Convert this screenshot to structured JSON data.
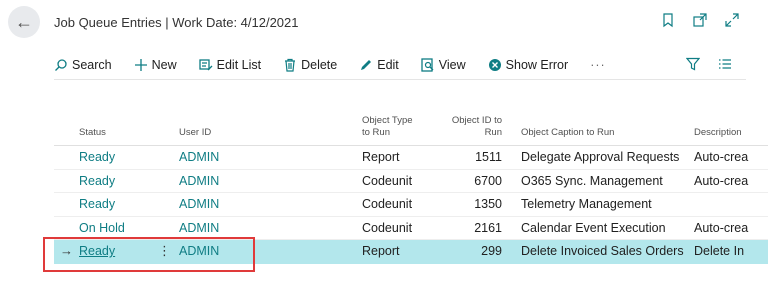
{
  "header": {
    "back_label": "←",
    "title": "Job Queue Entries | Work Date: 4/12/2021",
    "icons": [
      "bookmark-icon",
      "open-new-window-icon",
      "expand-icon"
    ]
  },
  "toolbar": {
    "search": "Search",
    "new": "New",
    "edit_list": "Edit List",
    "delete": "Delete",
    "edit": "Edit",
    "view": "View",
    "show_error": "Show Error",
    "more": "···",
    "icons_right": [
      "filter-icon",
      "list-view-icon"
    ]
  },
  "table": {
    "headers": {
      "status": "Status",
      "user_id": "User ID",
      "object_type_1": "Object Type",
      "object_type_2": "to Run",
      "object_id_1": "Object ID to",
      "object_id_2": "Run",
      "caption": "Object Caption to Run",
      "description": "Description"
    },
    "rows": [
      {
        "status": "Ready",
        "user": "ADMIN",
        "type": "Report",
        "id": "1511",
        "caption": "Delegate Approval Requests",
        "desc": "Auto-crea"
      },
      {
        "status": "Ready",
        "user": "ADMIN",
        "type": "Codeunit",
        "id": "6700",
        "caption": "O365 Sync. Management",
        "desc": "Auto-crea"
      },
      {
        "status": "Ready",
        "user": "ADMIN",
        "type": "Codeunit",
        "id": "1350",
        "caption": "Telemetry Management",
        "desc": ""
      },
      {
        "status": "On Hold",
        "user": "ADMIN",
        "type": "Codeunit",
        "id": "2161",
        "caption": "Calendar Event Execution",
        "desc": "Auto-crea"
      },
      {
        "status": "Ready",
        "user": "ADMIN",
        "type": "Report",
        "id": "299",
        "caption": "Delete Invoiced Sales Orders",
        "desc": "Delete In"
      }
    ],
    "selected_arrow": "→",
    "kebab": "⋮"
  },
  "colors": {
    "accent": "#0f7d84",
    "selected_row": "#b3e7ec",
    "highlight": "#e03a3a"
  }
}
